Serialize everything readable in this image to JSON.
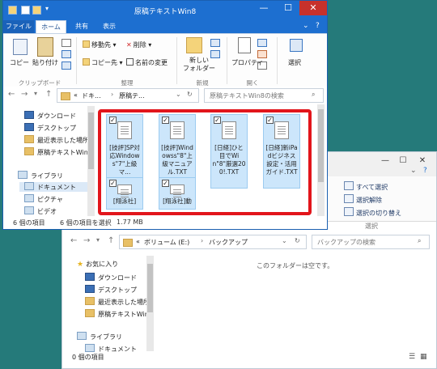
{
  "back_window": {
    "ribbon": {
      "select_all": "すべて選択",
      "select_none": "選択解除",
      "invert_selection": "選択の切り替え",
      "group_select": "選択"
    },
    "address": {
      "prefix": "«",
      "segment1": "ボリューム (E:)",
      "segment2": "バックアップ"
    },
    "search_placeholder": "バックアップの検索",
    "empty_message": "このフォルダーは空です。",
    "nav": {
      "favorites": "お気に入り",
      "downloads": "ダウンロード",
      "desktop": "デスクトップ",
      "recent": "最近表示した場所",
      "folder": "原稿テキストWin8",
      "libraries": "ライブラリ",
      "documents": "ドキュメント"
    },
    "status": "0 個の項目"
  },
  "front_window": {
    "title": "原稿テキストWin8",
    "tabs": {
      "file": "ファイル",
      "home": "ホーム",
      "share": "共有",
      "view": "表示"
    },
    "ribbon": {
      "copy": "コピー",
      "paste": "貼り付け",
      "move_to": "移動先",
      "copy_to": "コピー先",
      "delete": "削除",
      "rename": "名前の変更",
      "new_folder_line1": "新しい",
      "new_folder_line2": "フォルダー",
      "properties": "プロパティ",
      "select": "選択",
      "group_clipboard": "クリップボード",
      "group_organize": "整理",
      "group_new": "新規",
      "group_open": "開く"
    },
    "address": {
      "prefix": "«",
      "segment1": "ドキ...",
      "segment2": "原稿テ..."
    },
    "search_placeholder": "原稿テキストWin8の検索",
    "nav": {
      "downloads": "ダウンロード",
      "desktop": "デスクトップ",
      "recent": "最近表示した場所",
      "folder": "原稿テキストWin8",
      "libraries": "ライブラリ",
      "documents": "ドキュメント",
      "pictures": "ピクチャ",
      "videos": "ビデオ"
    },
    "files": [
      {
        "name": "[技評]SP対応Windows\"7\"上級マ..."
      },
      {
        "name": "[技評]Windowss\"8\"上級マニュアル.TXT"
      },
      {
        "name": "[日経]ひと目でWin\"8\"厳選200!.TXT"
      },
      {
        "name": "[日経]新iPadビジネス設定・活用ガイド.TXT"
      },
      {
        "name": "[翔泳社]"
      },
      {
        "name": "[翔泳社]動"
      }
    ],
    "status": {
      "count": "6 個の項目",
      "selected": "6 個の項目を選択",
      "size": "1.77 MB"
    }
  },
  "colors": {
    "desktop": "#257a7a",
    "titlebar": "#1d6fd0",
    "close_button": "#c7312b",
    "selection": "#cce6fb",
    "highlight_box": "#e2151b"
  }
}
